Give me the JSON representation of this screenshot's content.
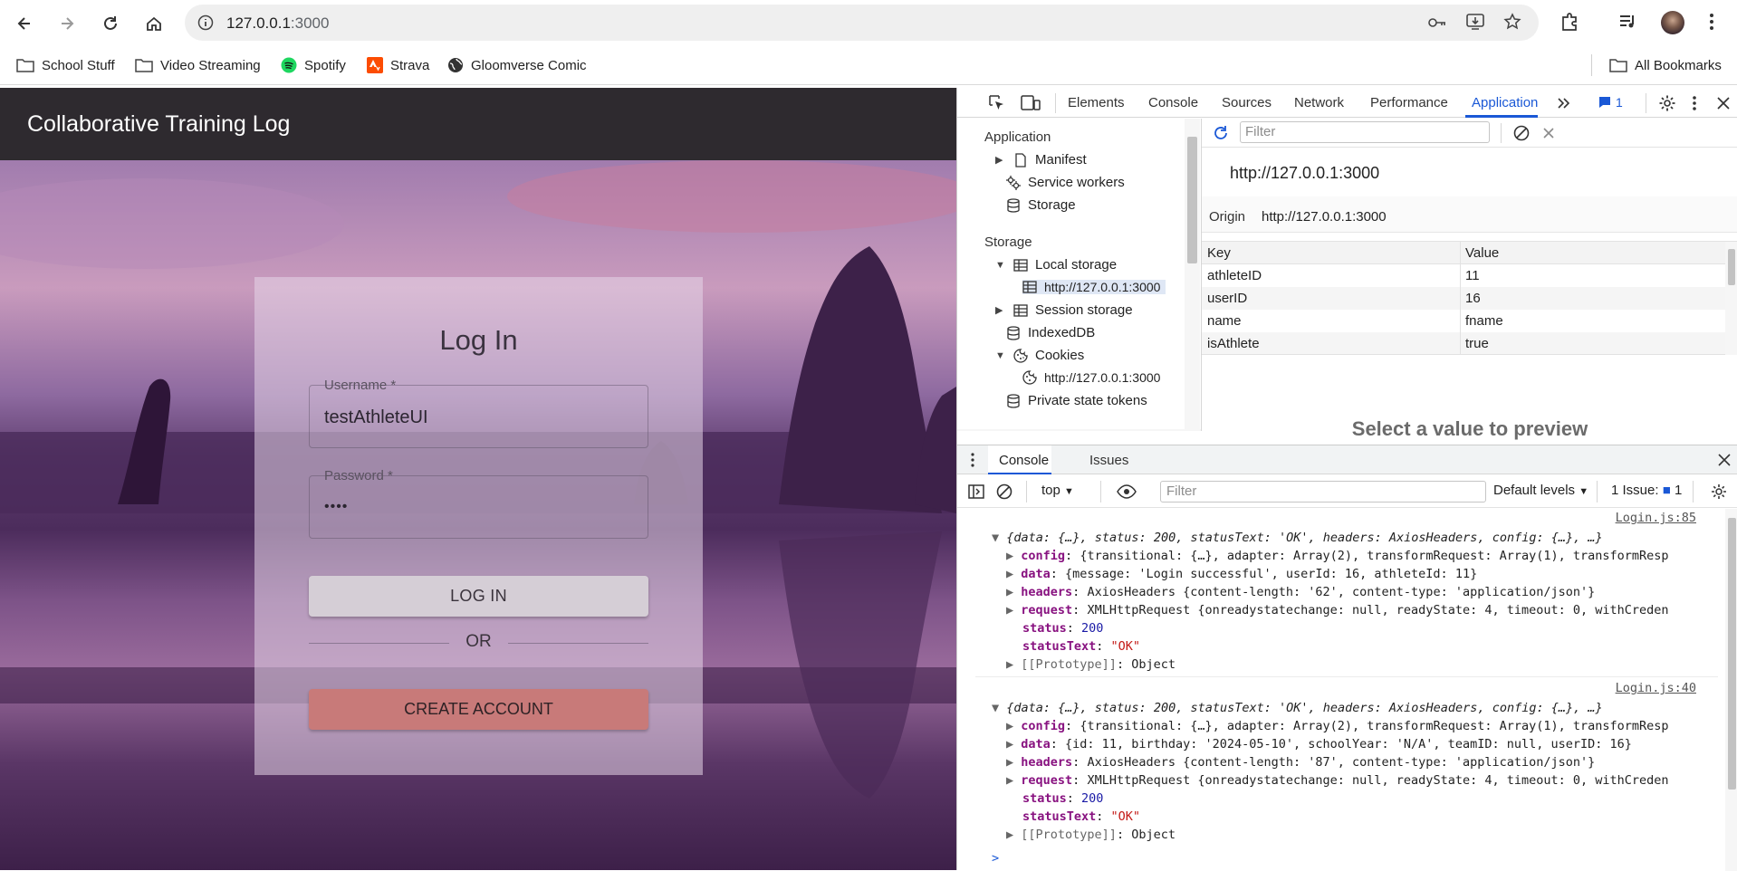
{
  "browser": {
    "url_host": "127.0.0.1",
    "url_port": ":3000",
    "bookmarks": [
      "School Stuff",
      "Video Streaming",
      "Spotify",
      "Strava",
      "Gloomverse Comic"
    ],
    "all_bookmarks": "All Bookmarks"
  },
  "app": {
    "title": "Collaborative Training Log",
    "login": {
      "heading": "Log In",
      "username_label": "Username *",
      "username_value": "testAthleteUI",
      "password_label": "Password *",
      "password_value": "••••",
      "login_button": "LOG IN",
      "or": "OR",
      "create_button": "CREATE ACCOUNT"
    }
  },
  "devtools": {
    "tabs": [
      "Elements",
      "Console",
      "Sources",
      "Network",
      "Performance",
      "Application"
    ],
    "active_tab": "Application",
    "issues_badge": "1",
    "sidebar": {
      "application_header": "Application",
      "manifest": "Manifest",
      "service_workers": "Service workers",
      "storage_item": "Storage",
      "storage_header": "Storage",
      "local_storage": "Local storage",
      "local_origin": "http://127.0.0.1:3000",
      "session_storage": "Session storage",
      "indexeddb": "IndexedDB",
      "cookies": "Cookies",
      "cookies_origin": "http://127.0.0.1:3000",
      "private_state_tokens": "Private state tokens"
    },
    "storage_view": {
      "filter_placeholder": "Filter",
      "origin_title": "http://127.0.0.1:3000",
      "origin_label": "Origin",
      "origin_value": "http://127.0.0.1:3000",
      "columns": [
        "Key",
        "Value"
      ],
      "rows": [
        {
          "key": "athleteID",
          "value": "11"
        },
        {
          "key": "userID",
          "value": "16"
        },
        {
          "key": "name",
          "value": "fname"
        },
        {
          "key": "isAthlete",
          "value": "true"
        }
      ],
      "preview_text": "Select a value to preview"
    },
    "drawer": {
      "tabs": [
        "Console",
        "Issues"
      ],
      "context": "top",
      "filter_placeholder": "Filter",
      "levels": "Default levels",
      "issues_label": "1 Issue:",
      "issues_count": "1",
      "logs": [
        {
          "source": "Login.js:85",
          "summary": "{data: {…}, status: 200, statusText: 'OK', headers: AxiosHeaders, config: {…}, …}",
          "lines": [
            {
              "key": "config",
              "text": "{transitional: {…}, adapter: Array(2), transformRequest: Array(1), transformResp"
            },
            {
              "key": "data",
              "text": "{message: 'Login successful', userId: 16, athleteId: 11}"
            },
            {
              "key": "headers",
              "text": "AxiosHeaders {content-length: '62', content-type: 'application/json'}"
            },
            {
              "key": "request",
              "text": "XMLHttpRequest {onreadystatechange: null, readyState: 4, timeout: 0, withCreden"
            },
            {
              "key": "status",
              "text": "200"
            },
            {
              "key": "statusText",
              "text": "\"OK\""
            },
            {
              "key": "[[Prototype]]",
              "text": "Object"
            }
          ]
        },
        {
          "source": "Login.js:40",
          "summary": "{data: {…}, status: 200, statusText: 'OK', headers: AxiosHeaders, config: {…}, …}",
          "lines": [
            {
              "key": "config",
              "text": "{transitional: {…}, adapter: Array(2), transformRequest: Array(1), transformResp"
            },
            {
              "key": "data",
              "text": "{id: 11, birthday: '2024-05-10', schoolYear: 'N/A', teamID: null, userID: 16}"
            },
            {
              "key": "headers",
              "text": "AxiosHeaders {content-length: '87', content-type: 'application/json'}"
            },
            {
              "key": "request",
              "text": "XMLHttpRequest {onreadystatechange: null, readyState: 4, timeout: 0, withCreden"
            },
            {
              "key": "status",
              "text": "200"
            },
            {
              "key": "statusText",
              "text": "\"OK\""
            },
            {
              "key": "[[Prototype]]",
              "text": "Object"
            }
          ]
        }
      ]
    }
  }
}
